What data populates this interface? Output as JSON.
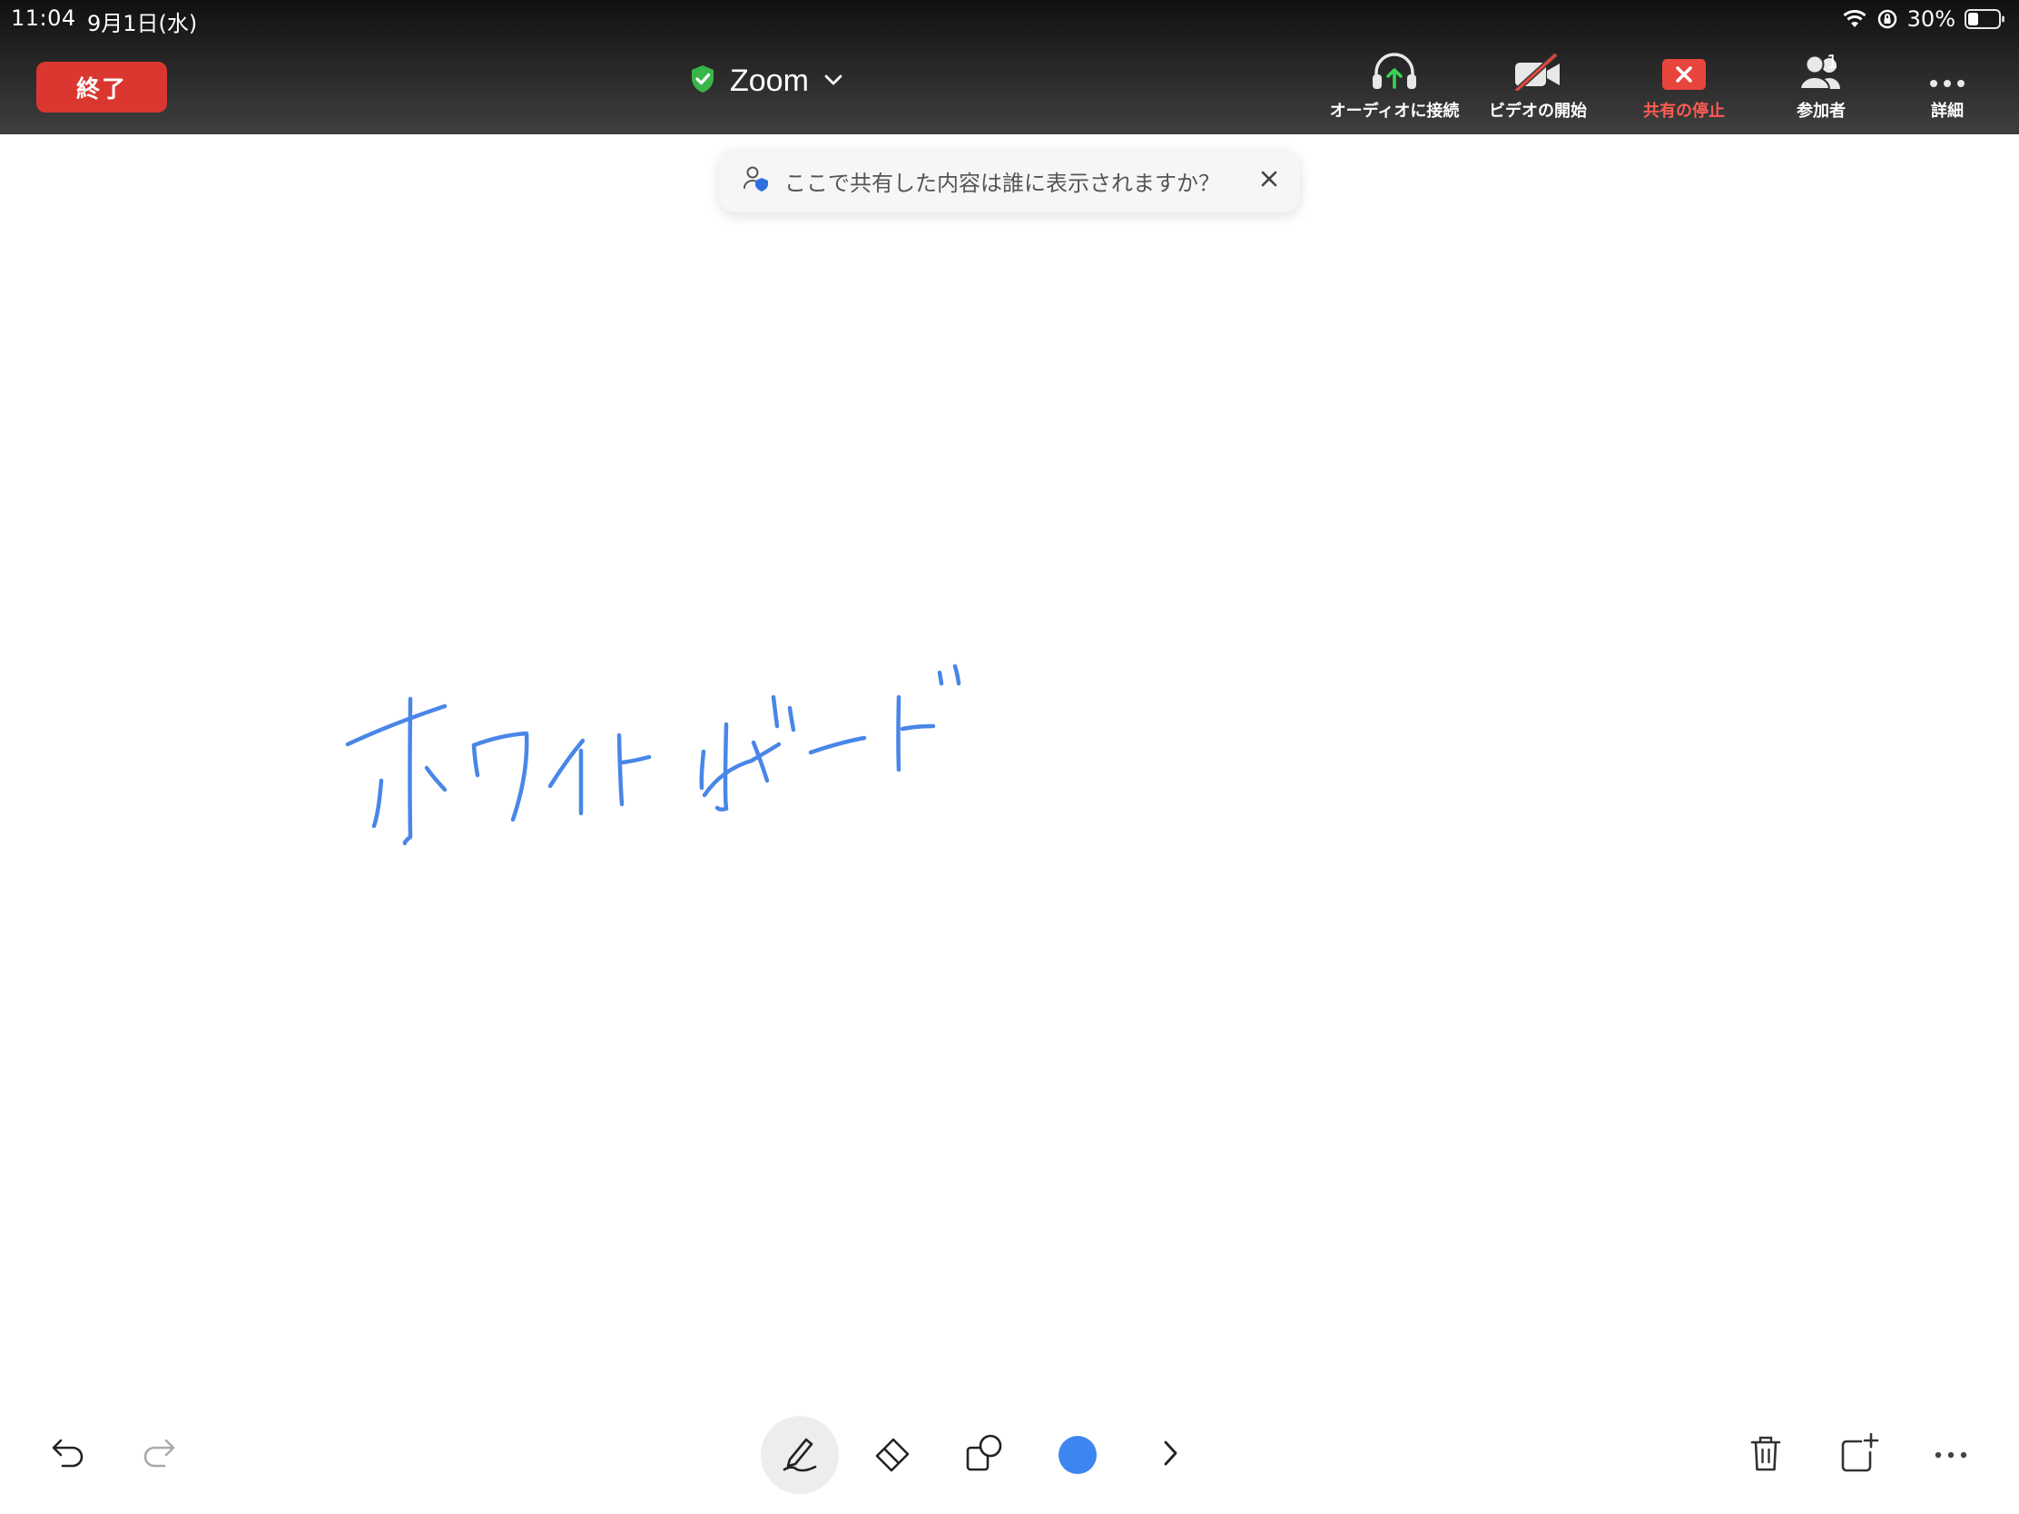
{
  "status_bar": {
    "time": "11:04",
    "date": "9月1日(水)",
    "battery": "30%"
  },
  "header": {
    "end_button": "終了",
    "meeting_name": "Zoom",
    "toolbar": [
      {
        "id": "audio",
        "label": "オーディオに接続",
        "icon": "headphones-icon"
      },
      {
        "id": "video",
        "label": "ビデオの開始",
        "icon": "video-off-icon"
      },
      {
        "id": "share",
        "label": "共有の停止",
        "icon": "stop-share-icon"
      },
      {
        "id": "participants",
        "label": "参加者",
        "icon": "participants-icon",
        "count": "1"
      },
      {
        "id": "more",
        "label": "詳細",
        "icon": "more-icon"
      }
    ]
  },
  "toast": {
    "text": "ここで共有した内容は誰に表示されますか？",
    "icon": "shield-person-icon"
  },
  "whiteboard": {
    "content": "ホワイトボード",
    "pen_color": "#4a86e8"
  },
  "bottom_toolbar": {
    "tools": [
      "undo-icon",
      "redo-icon",
      "pen-icon",
      "eraser-icon",
      "shapes-icon",
      "color-picker",
      "expand-chevron-icon",
      "trash-icon",
      "add-page-icon",
      "more-icon"
    ],
    "selected_color": "#3d85f0"
  },
  "colors": {
    "end_red": "#d9372f",
    "stop_red": "#ff5c54",
    "shield_green": "#39b54a",
    "ink_blue": "#4a86e8"
  }
}
